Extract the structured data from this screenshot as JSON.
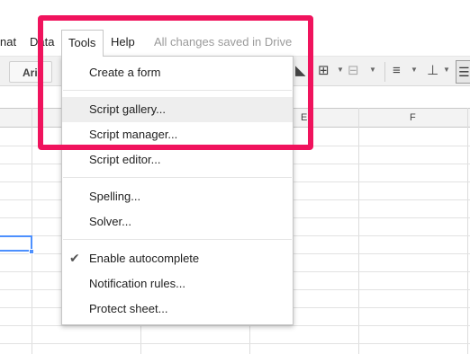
{
  "menubar": {
    "partial_format": "nat",
    "data": "Data",
    "tools": "Tools",
    "help": "Help",
    "status": "All changes saved in Drive"
  },
  "toolbar": {
    "font": "Ari",
    "icons": [
      "paint-format-icon",
      "borders-icon",
      "merge-cells-icon",
      "align-left-icon",
      "vertical-align-icon",
      "text-wrap-icon"
    ]
  },
  "grid": {
    "column_headers": [
      "E",
      "F"
    ]
  },
  "tools_menu": {
    "items": [
      {
        "label": "Create a form"
      },
      {
        "label": "Script gallery..."
      },
      {
        "label": "Script manager..."
      },
      {
        "label": "Script editor..."
      },
      {
        "label": "Spelling..."
      },
      {
        "label": "Solver..."
      },
      {
        "label": "Enable autocomplete",
        "checked": true
      },
      {
        "label": "Notification rules..."
      },
      {
        "label": "Protect sheet..."
      }
    ]
  },
  "colors": {
    "highlight": "#f0135d",
    "selection": "#4d90fe",
    "status_text": "#9a9a9a"
  }
}
